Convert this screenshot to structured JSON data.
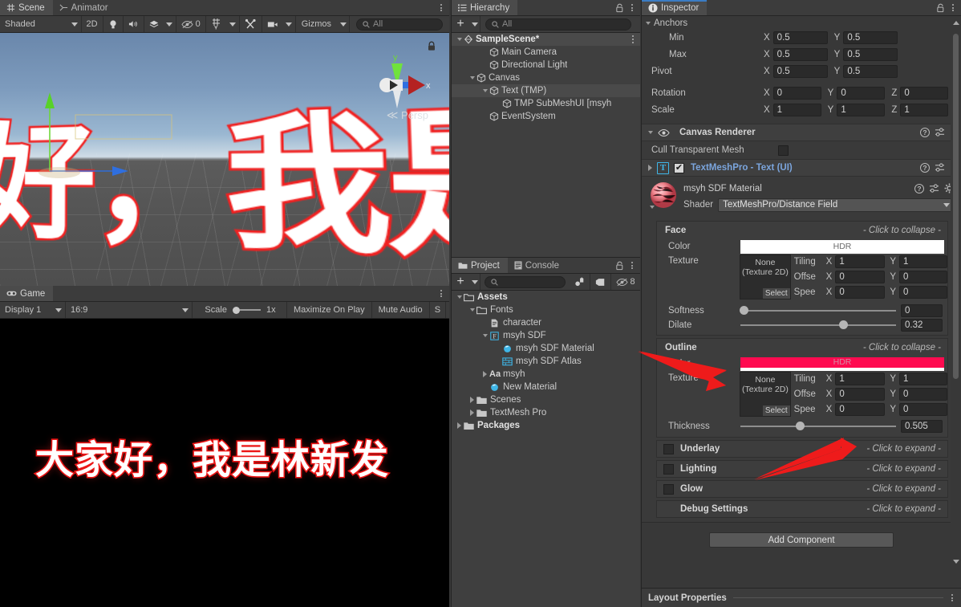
{
  "scene_panel": {
    "tabs": [
      {
        "label": "Scene",
        "icon": "grid-icon",
        "active": true
      },
      {
        "label": "Animator",
        "icon": "animator-icon",
        "active": false
      }
    ],
    "toolbar": {
      "draw_mode": "Shaded",
      "mode_2d": "2D",
      "lighting_icon": "lightbulb-icon",
      "audio_icon": "speaker-icon",
      "fx_icon": "layers-icon",
      "hidden_count": "0",
      "grid_icon": "grid-axis-icon",
      "tools_icon": "tools-icon",
      "camera_icon": "camera-icon",
      "gizmos_label": "Gizmos",
      "search_placeholder": "All"
    },
    "viewport": {
      "text": "好，我是林新发",
      "projection_label": "Persp",
      "gizmo_axis_x": "x",
      "gizmo_axis_y": "y",
      "lock_icon": "lock-icon"
    }
  },
  "game_panel": {
    "tabs": [
      {
        "label": "Game",
        "icon": "gamepad-icon",
        "active": true
      }
    ],
    "toolbar": {
      "display": "Display 1",
      "aspect": "16:9",
      "scale_label": "Scale",
      "scale_value": "1x",
      "maximize_on_play": "Maximize On Play",
      "mute_audio": "Mute Audio",
      "stats": "S"
    },
    "viewport": {
      "text": "大家好，我是林新发"
    }
  },
  "hierarchy": {
    "tab": "Hierarchy",
    "tab_icon": "hierarchy-icon",
    "lock_icon": "lock-icon",
    "add_label": "+",
    "search_placeholder": "All",
    "items": [
      {
        "label": "SampleScene*",
        "depth": 0,
        "expanded": true,
        "icon": "scene-icon",
        "selected": false,
        "is_scene": true
      },
      {
        "label": "Main Camera",
        "depth": 2,
        "expanded": null,
        "icon": "gameobject-icon",
        "selected": false
      },
      {
        "label": "Directional Light",
        "depth": 2,
        "expanded": null,
        "icon": "gameobject-icon",
        "selected": false
      },
      {
        "label": "Canvas",
        "depth": 1,
        "expanded": true,
        "icon": "gameobject-icon",
        "selected": false
      },
      {
        "label": "Text (TMP)",
        "depth": 2,
        "expanded": true,
        "icon": "gameobject-icon",
        "selected": true
      },
      {
        "label": "TMP SubMeshUI [msyh",
        "depth": 3,
        "expanded": null,
        "icon": "gameobject-icon",
        "selected": false
      },
      {
        "label": "EventSystem",
        "depth": 2,
        "expanded": null,
        "icon": "gameobject-icon",
        "selected": false
      }
    ]
  },
  "project": {
    "tabs": [
      {
        "label": "Project",
        "icon": "folder-icon",
        "active": true
      },
      {
        "label": "Console",
        "icon": "console-icon",
        "active": false
      }
    ],
    "lock_icon": "lock-icon",
    "search_placeholder": "",
    "toolbar_icons": [
      "favorites-icon",
      "label-icon",
      "hidden-packages-icon"
    ],
    "hidden_count": "8",
    "items": [
      {
        "label": "Assets",
        "depth": 0,
        "expanded": true,
        "icon": "folder-open-icon",
        "bold": true
      },
      {
        "label": "Fonts",
        "depth": 1,
        "expanded": true,
        "icon": "folder-open-icon",
        "bold": false
      },
      {
        "label": "character",
        "depth": 2,
        "expanded": null,
        "icon": "text-asset-icon",
        "bold": false
      },
      {
        "label": "msyh SDF",
        "depth": 2,
        "expanded": true,
        "icon": "font-asset-icon",
        "bold": false
      },
      {
        "label": "msyh SDF Material",
        "depth": 3,
        "expanded": null,
        "icon": "material-icon",
        "bold": false
      },
      {
        "label": "msyh SDF Atlas",
        "depth": 3,
        "expanded": null,
        "icon": "atlas-icon",
        "bold": false
      },
      {
        "label": "msyh",
        "depth": 2,
        "expanded": false,
        "icon": "font-icon",
        "bold": false
      },
      {
        "label": "New Material",
        "depth": 2,
        "expanded": null,
        "icon": "material-icon",
        "bold": false
      },
      {
        "label": "Scenes",
        "depth": 1,
        "expanded": false,
        "icon": "folder-icon",
        "bold": false
      },
      {
        "label": "TextMesh Pro",
        "depth": 1,
        "expanded": false,
        "icon": "folder-icon",
        "bold": false
      },
      {
        "label": "Packages",
        "depth": 0,
        "expanded": false,
        "icon": "folder-icon",
        "bold": true
      }
    ]
  },
  "inspector": {
    "tab": "Inspector",
    "tab_icon": "info-icon",
    "lock_icon": "lock-icon",
    "rect_transform": {
      "anchors_label": "Anchors",
      "rows": [
        {
          "label": "Min",
          "fields": [
            {
              "axis": "X",
              "value": "0.5"
            },
            {
              "axis": "Y",
              "value": "0.5"
            }
          ]
        },
        {
          "label": "Max",
          "fields": [
            {
              "axis": "X",
              "value": "0.5"
            },
            {
              "axis": "Y",
              "value": "0.5"
            }
          ]
        },
        {
          "label": "Pivot",
          "fields": [
            {
              "axis": "X",
              "value": "0.5"
            },
            {
              "axis": "Y",
              "value": "0.5"
            }
          ]
        }
      ],
      "rows2": [
        {
          "label": "Rotation",
          "fields": [
            {
              "axis": "X",
              "value": "0"
            },
            {
              "axis": "Y",
              "value": "0"
            },
            {
              "axis": "Z",
              "value": "0"
            }
          ]
        },
        {
          "label": "Scale",
          "fields": [
            {
              "axis": "X",
              "value": "1"
            },
            {
              "axis": "Y",
              "value": "1"
            },
            {
              "axis": "Z",
              "value": "1"
            }
          ]
        }
      ]
    },
    "canvas_renderer": {
      "title": "Canvas Renderer",
      "eye_icon": "eye-icon",
      "cull_label": "Cull Transparent Mesh",
      "cull_checked": false
    },
    "tmp_component": {
      "title": "TextMeshPro - Text (UI)",
      "badge": "T",
      "enabled": true
    },
    "material": {
      "name": "msyh SDF Material",
      "preview_icon": "material-sphere-icon",
      "shader_label": "Shader",
      "shader_value": "TextMeshPro/Distance Field"
    },
    "face": {
      "name": "Face",
      "hint": "- Click to collapse -",
      "color_label": "Color",
      "color_hdr": "HDR",
      "color_hex": "#ffffff",
      "texture_label": "Texture",
      "texture_value": "None (Texture 2D)",
      "texture_select": "Select",
      "tiling_label": "Tiling",
      "tiling": [
        {
          "axis": "X",
          "value": "1"
        },
        {
          "axis": "Y",
          "value": "1"
        }
      ],
      "offset_label": "Offse",
      "offset": [
        {
          "axis": "X",
          "value": "0"
        },
        {
          "axis": "Y",
          "value": "0"
        }
      ],
      "speed_label": "Spee",
      "speed": [
        {
          "axis": "X",
          "value": "0"
        },
        {
          "axis": "Y",
          "value": "0"
        }
      ],
      "softness_label": "Softness",
      "softness_value": "0",
      "softness_pct": 2,
      "dilate_label": "Dilate",
      "dilate_value": "0.32",
      "dilate_pct": 66
    },
    "outline": {
      "name": "Outline",
      "hint": "- Click to collapse -",
      "color_label": "Color",
      "color_hdr": "HDR",
      "color_hex": "#ff0b50",
      "texture_label": "Texture",
      "texture_value": "None (Texture 2D)",
      "texture_select": "Select",
      "tiling_label": "Tiling",
      "tiling": [
        {
          "axis": "X",
          "value": "1"
        },
        {
          "axis": "Y",
          "value": "1"
        }
      ],
      "offset_label": "Offse",
      "offset": [
        {
          "axis": "X",
          "value": "0"
        },
        {
          "axis": "Y",
          "value": "0"
        }
      ],
      "speed_label": "Spee",
      "speed": [
        {
          "axis": "X",
          "value": "0"
        },
        {
          "axis": "Y",
          "value": "0"
        }
      ],
      "thickness_label": "Thickness",
      "thickness_value": "0.505",
      "thickness_pct": 38
    },
    "collapsed_sections": [
      {
        "name": "Underlay",
        "hint": "- Click to expand  -",
        "has_checkbox": true
      },
      {
        "name": "Lighting",
        "hint": "- Click to expand  -",
        "has_checkbox": true
      },
      {
        "name": "Glow",
        "hint": "- Click to expand  -",
        "has_checkbox": true
      },
      {
        "name": "Debug Settings",
        "hint": "- Click to expand  -",
        "has_checkbox": false
      }
    ],
    "add_component": "Add Component",
    "layout_properties": "Layout Properties"
  },
  "colors": {
    "outline_accent": "#ff0b50",
    "selection_blue": "#3b7cc4",
    "tmp_blue": "#7ba5dd",
    "arrow_red": "#ee1b1b"
  }
}
